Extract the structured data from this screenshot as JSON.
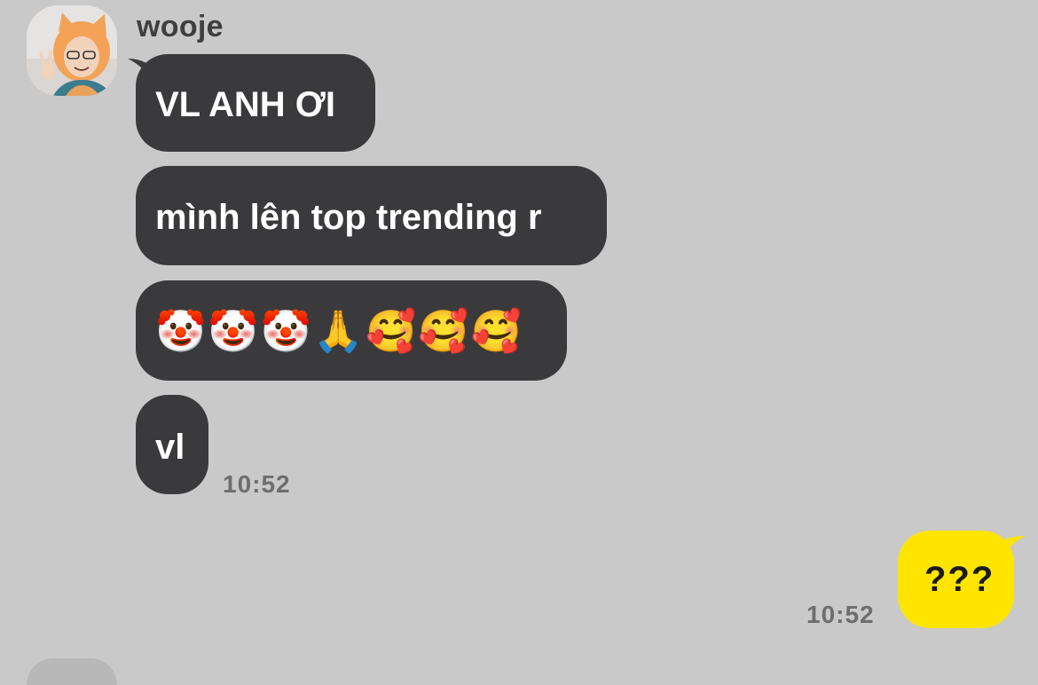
{
  "chat": {
    "sender_name": "wooje",
    "incoming_messages": [
      {
        "text": "VL ANH ƠI"
      },
      {
        "text": "mình lên top trending r"
      },
      {
        "text": "🤡🤡🤡🙏🥰🥰🥰"
      },
      {
        "text": "vl"
      }
    ],
    "incoming_time": "10:52",
    "outgoing_message": {
      "text": "???"
    },
    "outgoing_time": "10:52"
  },
  "colors": {
    "background": "#c9c9c9",
    "incoming_bubble": "#3a3a3c",
    "outgoing_bubble": "#fee500",
    "timestamp": "#6e6e6e"
  },
  "icons": {
    "avatar": "profile-photo-avatar"
  }
}
